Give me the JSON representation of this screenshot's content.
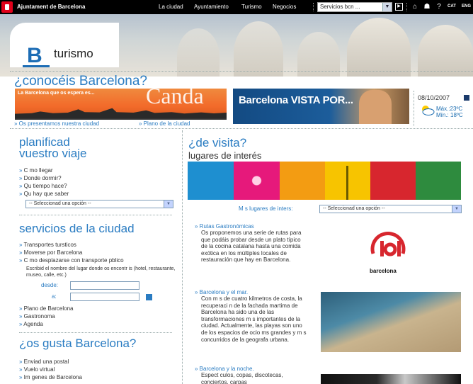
{
  "topbar": {
    "site_title": "Ajuntament de Barcelona",
    "nav": [
      "La ciudad",
      "Ayuntamiento",
      "Turismo",
      "Negocios"
    ],
    "services_select": "Servicios bcn ...",
    "icons": [
      "home-icon",
      "sitemap-icon",
      "help-icon"
    ],
    "langs": [
      "CAT",
      "ENG"
    ]
  },
  "header": {
    "logo_letter": "B",
    "section": "turismo"
  },
  "hero": {
    "heading": "¿conocéis Barcelona?",
    "banner1_text": "La Barcelona que os espera es...",
    "banner1_word": "Canda",
    "banner2_text": "Barcelona VISTA POR...",
    "links": [
      "Os presentamos nuestra ciudad",
      "Plano de la ciudad"
    ]
  },
  "weather": {
    "date": "08/10/2007",
    "max": "Máx.:23ºC",
    "min": "Mín.: 18ºC",
    "icon": "sun-cloud-icon"
  },
  "planificad": {
    "heading1": "planificad",
    "heading2": "vuestro viaje",
    "links": [
      "C mo llegar",
      "Donde dormir?",
      "Qu tiempo hace?",
      "Qu hay que saber"
    ],
    "select": "-- Seleccionad una opción --"
  },
  "servicios": {
    "heading": "servicios de la ciudad",
    "links": [
      "Transportes tursticos",
      "Moverse por Barcelona",
      "C mo desplazarse con transporte pblico"
    ],
    "instructions": "Escribid el nombre del lugar donde os encontr is (hotel, restaurante, museo, calle, etc.)",
    "desde": "desde:",
    "a": "a:",
    "links2": [
      "Plano de Barcelona",
      "Gastronoma",
      "Agenda"
    ]
  },
  "gusta": {
    "heading": "¿os gusta Barcelona?",
    "links": [
      "Enviad una postal",
      "Vuelo virtual",
      "Im genes de Barcelona"
    ]
  },
  "visita": {
    "heading": "¿de visita?",
    "sub": "lugares de interés",
    "more_label": "M s lugares de inters:",
    "select": "-- Seleccionad una opción --",
    "strip_colors": [
      "#1e8fd0",
      "#e6197b",
      "#f39c12",
      "#f7c400",
      "#6db33f",
      "#d7262e",
      "#2e8b3e"
    ]
  },
  "items": [
    {
      "title": "Rutas Gastronómicas",
      "desc": "Os proponemos una serie de rutas para que podáis probar desde un plato típico de la cocina catalana hasta una comida exótica en los múltiples locales de restauración que hay en Barcelona.",
      "logo_text": "barcelona"
    },
    {
      "title": "Barcelona y el mar.",
      "desc": "Con m s de cuatro kilmetros de costa, la recuperaci n de la fachada martima de Barcelona ha sido una de las transformaciones m s importantes de la ciudad. Actualmente, las playas son uno de los espacios de ocio ms grandes y m s concurridos de la geografa urbana."
    },
    {
      "title": "Barcelona y la noche.",
      "desc": "Espect culos, copas, discotecas, conciertos, carpas"
    }
  ]
}
